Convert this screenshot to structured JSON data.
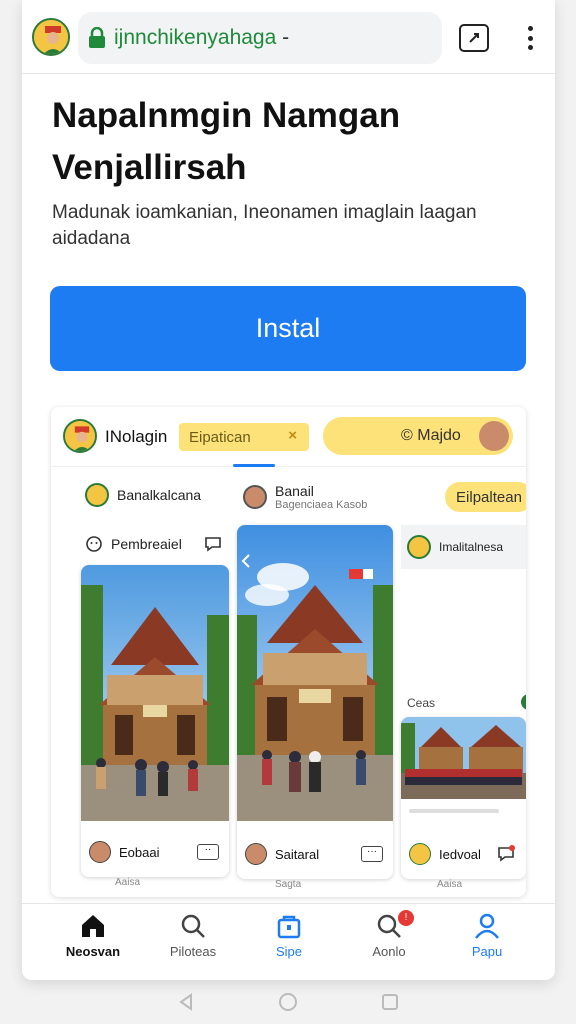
{
  "browser": {
    "url_host": "ijnnchikenyahaga",
    "url_rest": " -",
    "icons": [
      "browser-avatar",
      "lock-icon",
      "tab-switcher-icon",
      "overflow-menu-icon"
    ]
  },
  "page": {
    "title": "Napalnmgin Namgan Venjallirsah",
    "description": "Madunak ioamkanian, Ineonamen imaglain laagan aidadana",
    "install_label": "Instal"
  },
  "preview": {
    "app_name": "INolagin",
    "search_text": "Eipatican",
    "search_clear": "×",
    "pill_label": "© Majdo",
    "col1": {
      "account_name": "Banalkalcana",
      "action_label": "Pembreaiel",
      "footer_name": "Eobaai",
      "footer_sub": "Aaisa"
    },
    "col2": {
      "account_name": "Banail",
      "account_sub": "Bagenciaea Kasob",
      "footer_name": "Saitaral",
      "footer_sub": "Sagta"
    },
    "col3": {
      "button_label": "Eilpaltean",
      "account_name": "Imalitalnesa",
      "section_label": "Ceas",
      "footer_name": "Iedvoal",
      "footer_sub": "Aaisa"
    }
  },
  "bottom_nav": [
    {
      "label": "Neosvan",
      "icon": "home-icon"
    },
    {
      "label": "Piloteas",
      "icon": "search-icon"
    },
    {
      "label": "Sipe",
      "icon": "shop-icon"
    },
    {
      "label": "Aonlo",
      "icon": "notification-search-icon",
      "badge": "!"
    },
    {
      "label": "Papu",
      "icon": "profile-icon"
    }
  ],
  "colors": {
    "accent": "#1d7cf2",
    "highlight": "#fde27a",
    "secure": "#1e8a3a"
  }
}
